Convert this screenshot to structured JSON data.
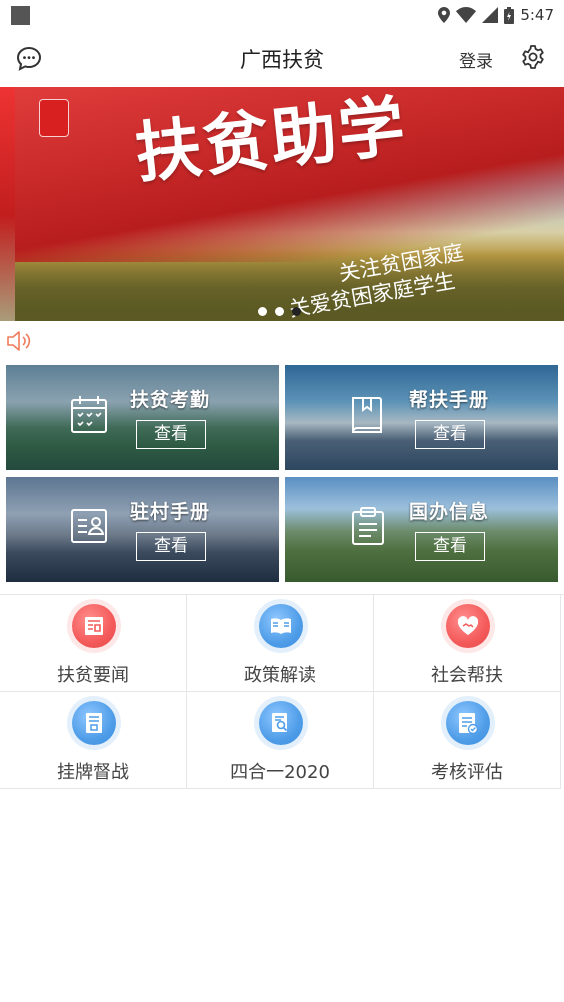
{
  "status_bar": {
    "time": "5:47"
  },
  "header": {
    "title": "广西扶贫",
    "login_label": "登录"
  },
  "banner": {
    "title": "扶贫助学",
    "line1": "关注贫困家庭",
    "line2": "关爱贫困家庭学生",
    "slide_count": 3,
    "active_slide": 3
  },
  "cards": [
    {
      "label": "扶贫考勤",
      "button": "查看",
      "icon": "calendar-check-icon"
    },
    {
      "label": "帮扶手册",
      "button": "查看",
      "icon": "book-icon"
    },
    {
      "label": "驻村手册",
      "button": "查看",
      "icon": "id-card-icon"
    },
    {
      "label": "国办信息",
      "button": "查看",
      "icon": "clipboard-icon"
    }
  ],
  "grid": [
    {
      "label": "扶贫要闻",
      "icon": "news-icon",
      "color": "#f45a5a"
    },
    {
      "label": "政策解读",
      "icon": "open-book-icon",
      "color": "#4f9de8"
    },
    {
      "label": "社会帮扶",
      "icon": "handshake-heart-icon",
      "color": "#f45a5a"
    },
    {
      "label": "挂牌督战",
      "icon": "document-icon",
      "color": "#4f9de8"
    },
    {
      "label": "四合一2020",
      "icon": "search-document-icon",
      "color": "#4f9de8"
    },
    {
      "label": "考核评估",
      "icon": "checklist-icon",
      "color": "#4f9de8"
    }
  ]
}
